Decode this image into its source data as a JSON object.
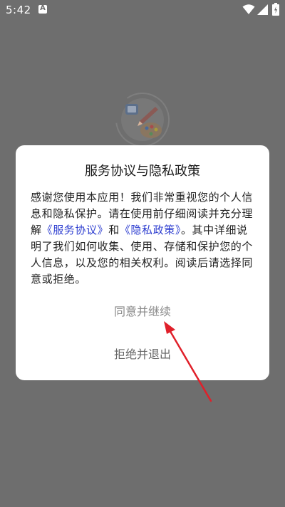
{
  "status_bar": {
    "time": "5:42",
    "notification_icon_letter": "A"
  },
  "dialog": {
    "title": "服务协议与隐私政策",
    "body_intro": "感谢您使用本应用！我们非常重视您的个人信息和隐私保护。请在使用前仔细阅读并充分理解",
    "service_link": "《服务协议》",
    "and_text": "和",
    "privacy_link": "《隐私政策》",
    "body_rest": "。其中详细说明了我们如何收集、使用、存储和保护您的个人信息，以及您的相关权利。阅读后请选择同意或拒绝。",
    "agree_label": "同意并继续",
    "exit_label": "拒绝并退出"
  },
  "colors": {
    "overlay": "#6e6e6e",
    "dialog_background": "#ffffff",
    "link": "#2f3fd0",
    "annotation": "#e0202a"
  },
  "icons": {
    "status": [
      "notification-a-icon",
      "wifi-icon",
      "signal-icon",
      "battery-icon"
    ],
    "app": "app-logo-icon",
    "annotation": "red-arrow-annotation"
  }
}
